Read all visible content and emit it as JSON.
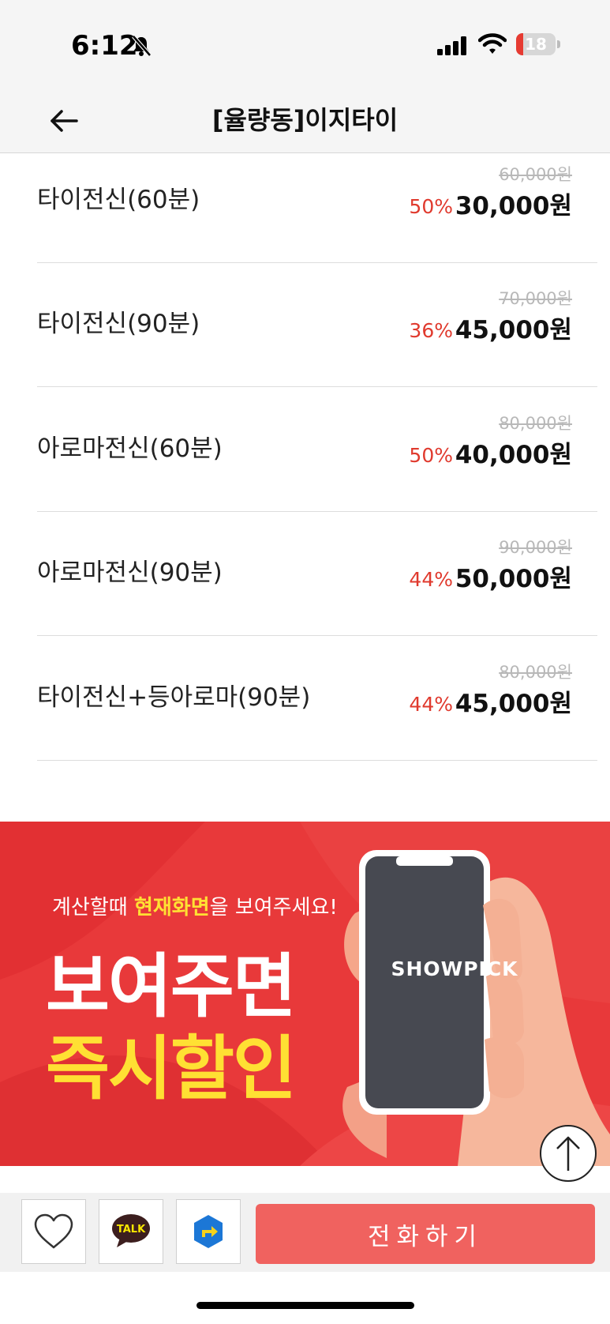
{
  "status_bar": {
    "time": "6:12",
    "battery_level": "18",
    "battery_fraction": 0.18,
    "icons": [
      "bell-slash-icon",
      "signal-icon",
      "wifi-icon",
      "battery-icon"
    ]
  },
  "header": {
    "title": "[율량동]이지타이",
    "back_icon": "back-arrow-icon"
  },
  "menu": [
    {
      "name": "타이전신(60분)",
      "original_price": "60,000원",
      "discount": "50%",
      "price": "30,000원"
    },
    {
      "name": "타이전신(90분)",
      "original_price": "70,000원",
      "discount": "36%",
      "price": "45,000원"
    },
    {
      "name": "아로마전신(60분)",
      "original_price": "80,000원",
      "discount": "50%",
      "price": "40,000원"
    },
    {
      "name": "아로마전신(90분)",
      "original_price": "90,000원",
      "discount": "44%",
      "price": "50,000원"
    },
    {
      "name": "타이전신+등아로마(90분)",
      "original_price": "80,000원",
      "discount": "44%",
      "price": "45,000원"
    }
  ],
  "banner": {
    "sub_before": "계산할때 ",
    "sub_highlight": "현재화면",
    "sub_after": "을 보여주세요!",
    "line1": "보여주면",
    "line2": "즉시할인",
    "brand": "SHOWPICK"
  },
  "bottom_bar": {
    "call_label": "전화하기",
    "talk_label": "TALK",
    "icons": [
      "heart-icon",
      "kakao-talk-icon",
      "directions-icon",
      "arrow-up-icon"
    ]
  },
  "colors": {
    "accent_red": "#e03a2e",
    "banner_red": "#e8393a",
    "highlight_yellow": "#ffe033",
    "call_button": "#f0625f"
  }
}
